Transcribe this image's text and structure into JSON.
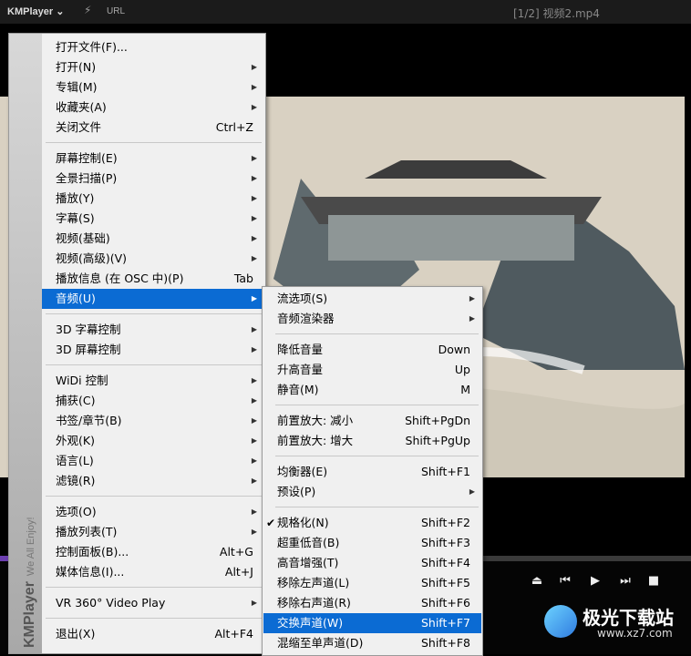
{
  "titlebar": {
    "app": "KMPlayer",
    "app_chevron": "chevron-down-icon",
    "url_label": "URL",
    "file_title": "[1/2] 视频2.mp4"
  },
  "brand": {
    "name": "KMPlayer",
    "tagline": "We All Enjoy!"
  },
  "playback": {
    "progress": 0.62
  },
  "main_menu": [
    {
      "label": "打开文件(F)...",
      "shortcut": "",
      "submenu": false
    },
    {
      "label": "打开(N)",
      "shortcut": "",
      "submenu": true
    },
    {
      "label": "专辑(M)",
      "shortcut": "",
      "submenu": true
    },
    {
      "label": "收藏夹(A)",
      "shortcut": "",
      "submenu": true
    },
    {
      "label": "关闭文件",
      "shortcut": "Ctrl+Z",
      "submenu": false
    },
    {
      "label": "屏幕控制(E)",
      "shortcut": "",
      "submenu": true
    },
    {
      "label": "全景扫描(P)",
      "shortcut": "",
      "submenu": true
    },
    {
      "label": "播放(Y)",
      "shortcut": "",
      "submenu": true
    },
    {
      "label": "字幕(S)",
      "shortcut": "",
      "submenu": true
    },
    {
      "label": "视频(基础)",
      "shortcut": "",
      "submenu": true
    },
    {
      "label": "视频(高级)(V)",
      "shortcut": "",
      "submenu": true
    },
    {
      "label": "播放信息 (在 OSC 中)(P)",
      "shortcut": "Tab",
      "submenu": false
    },
    {
      "label": "音频(U)",
      "shortcut": "",
      "submenu": true,
      "highlighted": true
    },
    {
      "label": "3D 字幕控制",
      "shortcut": "",
      "submenu": true
    },
    {
      "label": "3D 屏幕控制",
      "shortcut": "",
      "submenu": true
    },
    {
      "label": "WiDi 控制",
      "shortcut": "",
      "submenu": true
    },
    {
      "label": "捕获(C)",
      "shortcut": "",
      "submenu": true
    },
    {
      "label": "书签/章节(B)",
      "shortcut": "",
      "submenu": true
    },
    {
      "label": "外观(K)",
      "shortcut": "",
      "submenu": true
    },
    {
      "label": "语言(L)",
      "shortcut": "",
      "submenu": true
    },
    {
      "label": "滤镜(R)",
      "shortcut": "",
      "submenu": true
    },
    {
      "label": "选项(O)",
      "shortcut": "",
      "submenu": true
    },
    {
      "label": "播放列表(T)",
      "shortcut": "",
      "submenu": true
    },
    {
      "label": "控制面板(B)...",
      "shortcut": "Alt+G",
      "submenu": false
    },
    {
      "label": "媒体信息(I)...",
      "shortcut": "Alt+J",
      "submenu": false
    },
    {
      "label": "VR 360° Video Play",
      "shortcut": "",
      "submenu": true
    },
    {
      "label": "退出(X)",
      "shortcut": "Alt+F4",
      "submenu": false
    }
  ],
  "audio_menu": [
    {
      "label": "流选项(S)",
      "shortcut": "",
      "submenu": true
    },
    {
      "label": "音频渲染器",
      "shortcut": "",
      "submenu": true
    },
    {
      "label": "降低音量",
      "shortcut": "Down",
      "submenu": false
    },
    {
      "label": "升高音量",
      "shortcut": "Up",
      "submenu": false
    },
    {
      "label": "静音(M)",
      "shortcut": "M",
      "submenu": false
    },
    {
      "label": "前置放大: 减小",
      "shortcut": "Shift+PgDn",
      "submenu": false
    },
    {
      "label": "前置放大: 增大",
      "shortcut": "Shift+PgUp",
      "submenu": false
    },
    {
      "label": "均衡器(E)",
      "shortcut": "Shift+F1",
      "submenu": false
    },
    {
      "label": "预设(P)",
      "shortcut": "",
      "submenu": true
    },
    {
      "label": "规格化(N)",
      "shortcut": "Shift+F2",
      "submenu": false,
      "checked": true
    },
    {
      "label": "超重低音(B)",
      "shortcut": "Shift+F3",
      "submenu": false
    },
    {
      "label": "高音增强(T)",
      "shortcut": "Shift+F4",
      "submenu": false
    },
    {
      "label": "移除左声道(L)",
      "shortcut": "Shift+F5",
      "submenu": false
    },
    {
      "label": "移除右声道(R)",
      "shortcut": "Shift+F6",
      "submenu": false
    },
    {
      "label": "交换声道(W)",
      "shortcut": "Shift+F7",
      "submenu": false,
      "highlighted": true
    },
    {
      "label": "混缩至单声道(D)",
      "shortcut": "Shift+F8",
      "submenu": false
    }
  ],
  "controls": [
    {
      "name": "eject-icon",
      "glyph": "⏏"
    },
    {
      "name": "previous-icon",
      "glyph": "⏮"
    },
    {
      "name": "play-icon",
      "glyph": "▶"
    },
    {
      "name": "next-icon",
      "glyph": "⏭"
    },
    {
      "name": "stop-icon",
      "glyph": "■"
    }
  ],
  "watermark": {
    "title": "极光下载站",
    "url": "www.xz7.com"
  },
  "colors": {
    "highlight": "#0b6bd3",
    "progress": "#6c3fb0",
    "menu_bg": "#f0f0f0"
  }
}
